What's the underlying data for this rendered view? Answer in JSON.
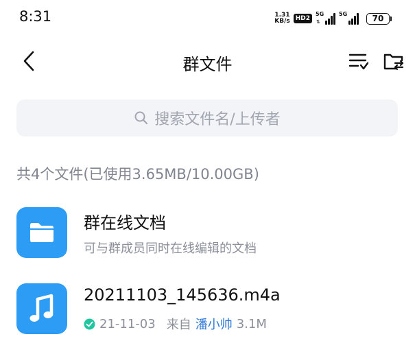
{
  "status_bar": {
    "time": "8:31",
    "net_speed_value": "1.31",
    "net_speed_unit": "KB/s",
    "hd_label": "HD2",
    "signal1_label": "5G",
    "signal2_label": "5G",
    "battery_level": "70"
  },
  "header": {
    "title": "群文件"
  },
  "search": {
    "placeholder": "搜索文件名/上传者"
  },
  "summary": "共4个文件(已使用3.65MB/10.00GB)",
  "files": [
    {
      "name": "群在线文档",
      "subtitle": "可与群成员同时在线编辑的文档",
      "icon": "folder-icon"
    },
    {
      "name": "20211103_145636.m4a",
      "date": "21-11-03",
      "from_label": "来自",
      "uploader": "潘小帅",
      "size": "3.1M",
      "icon": "music-note-icon"
    }
  ],
  "colors": {
    "accent": "#2d9cf5",
    "link": "#2f78d8",
    "success": "#1fc6a0",
    "search_bg": "#f3f4f8"
  }
}
